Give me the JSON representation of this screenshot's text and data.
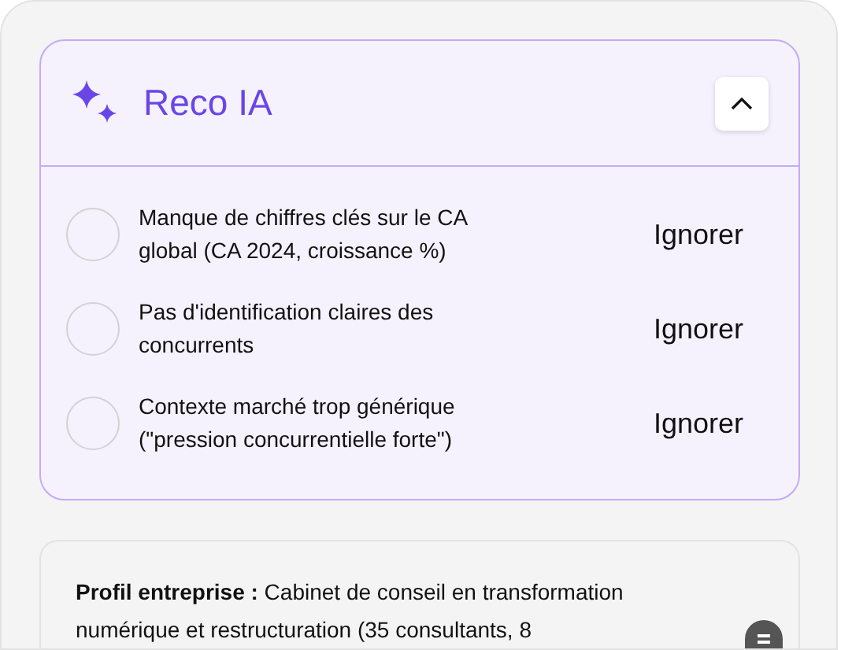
{
  "panel": {
    "title": "Reco IA",
    "expanded": true,
    "items": [
      {
        "text": "Manque de chiffres clés sur le CA global (CA 2024, croissance %)",
        "checked": false,
        "action": "Ignorer"
      },
      {
        "text": "Pas d'identification claires des concurrents",
        "checked": false,
        "action": "Ignorer"
      },
      {
        "text": "Contexte marché trop générique (\"pression concurrentielle forte\")",
        "checked": false,
        "action": "Ignorer"
      }
    ]
  },
  "profile": {
    "text": "**Profil entreprise :** Cabinet de conseil en transformation numérique et restructuration (35 consultants, 8"
  }
}
